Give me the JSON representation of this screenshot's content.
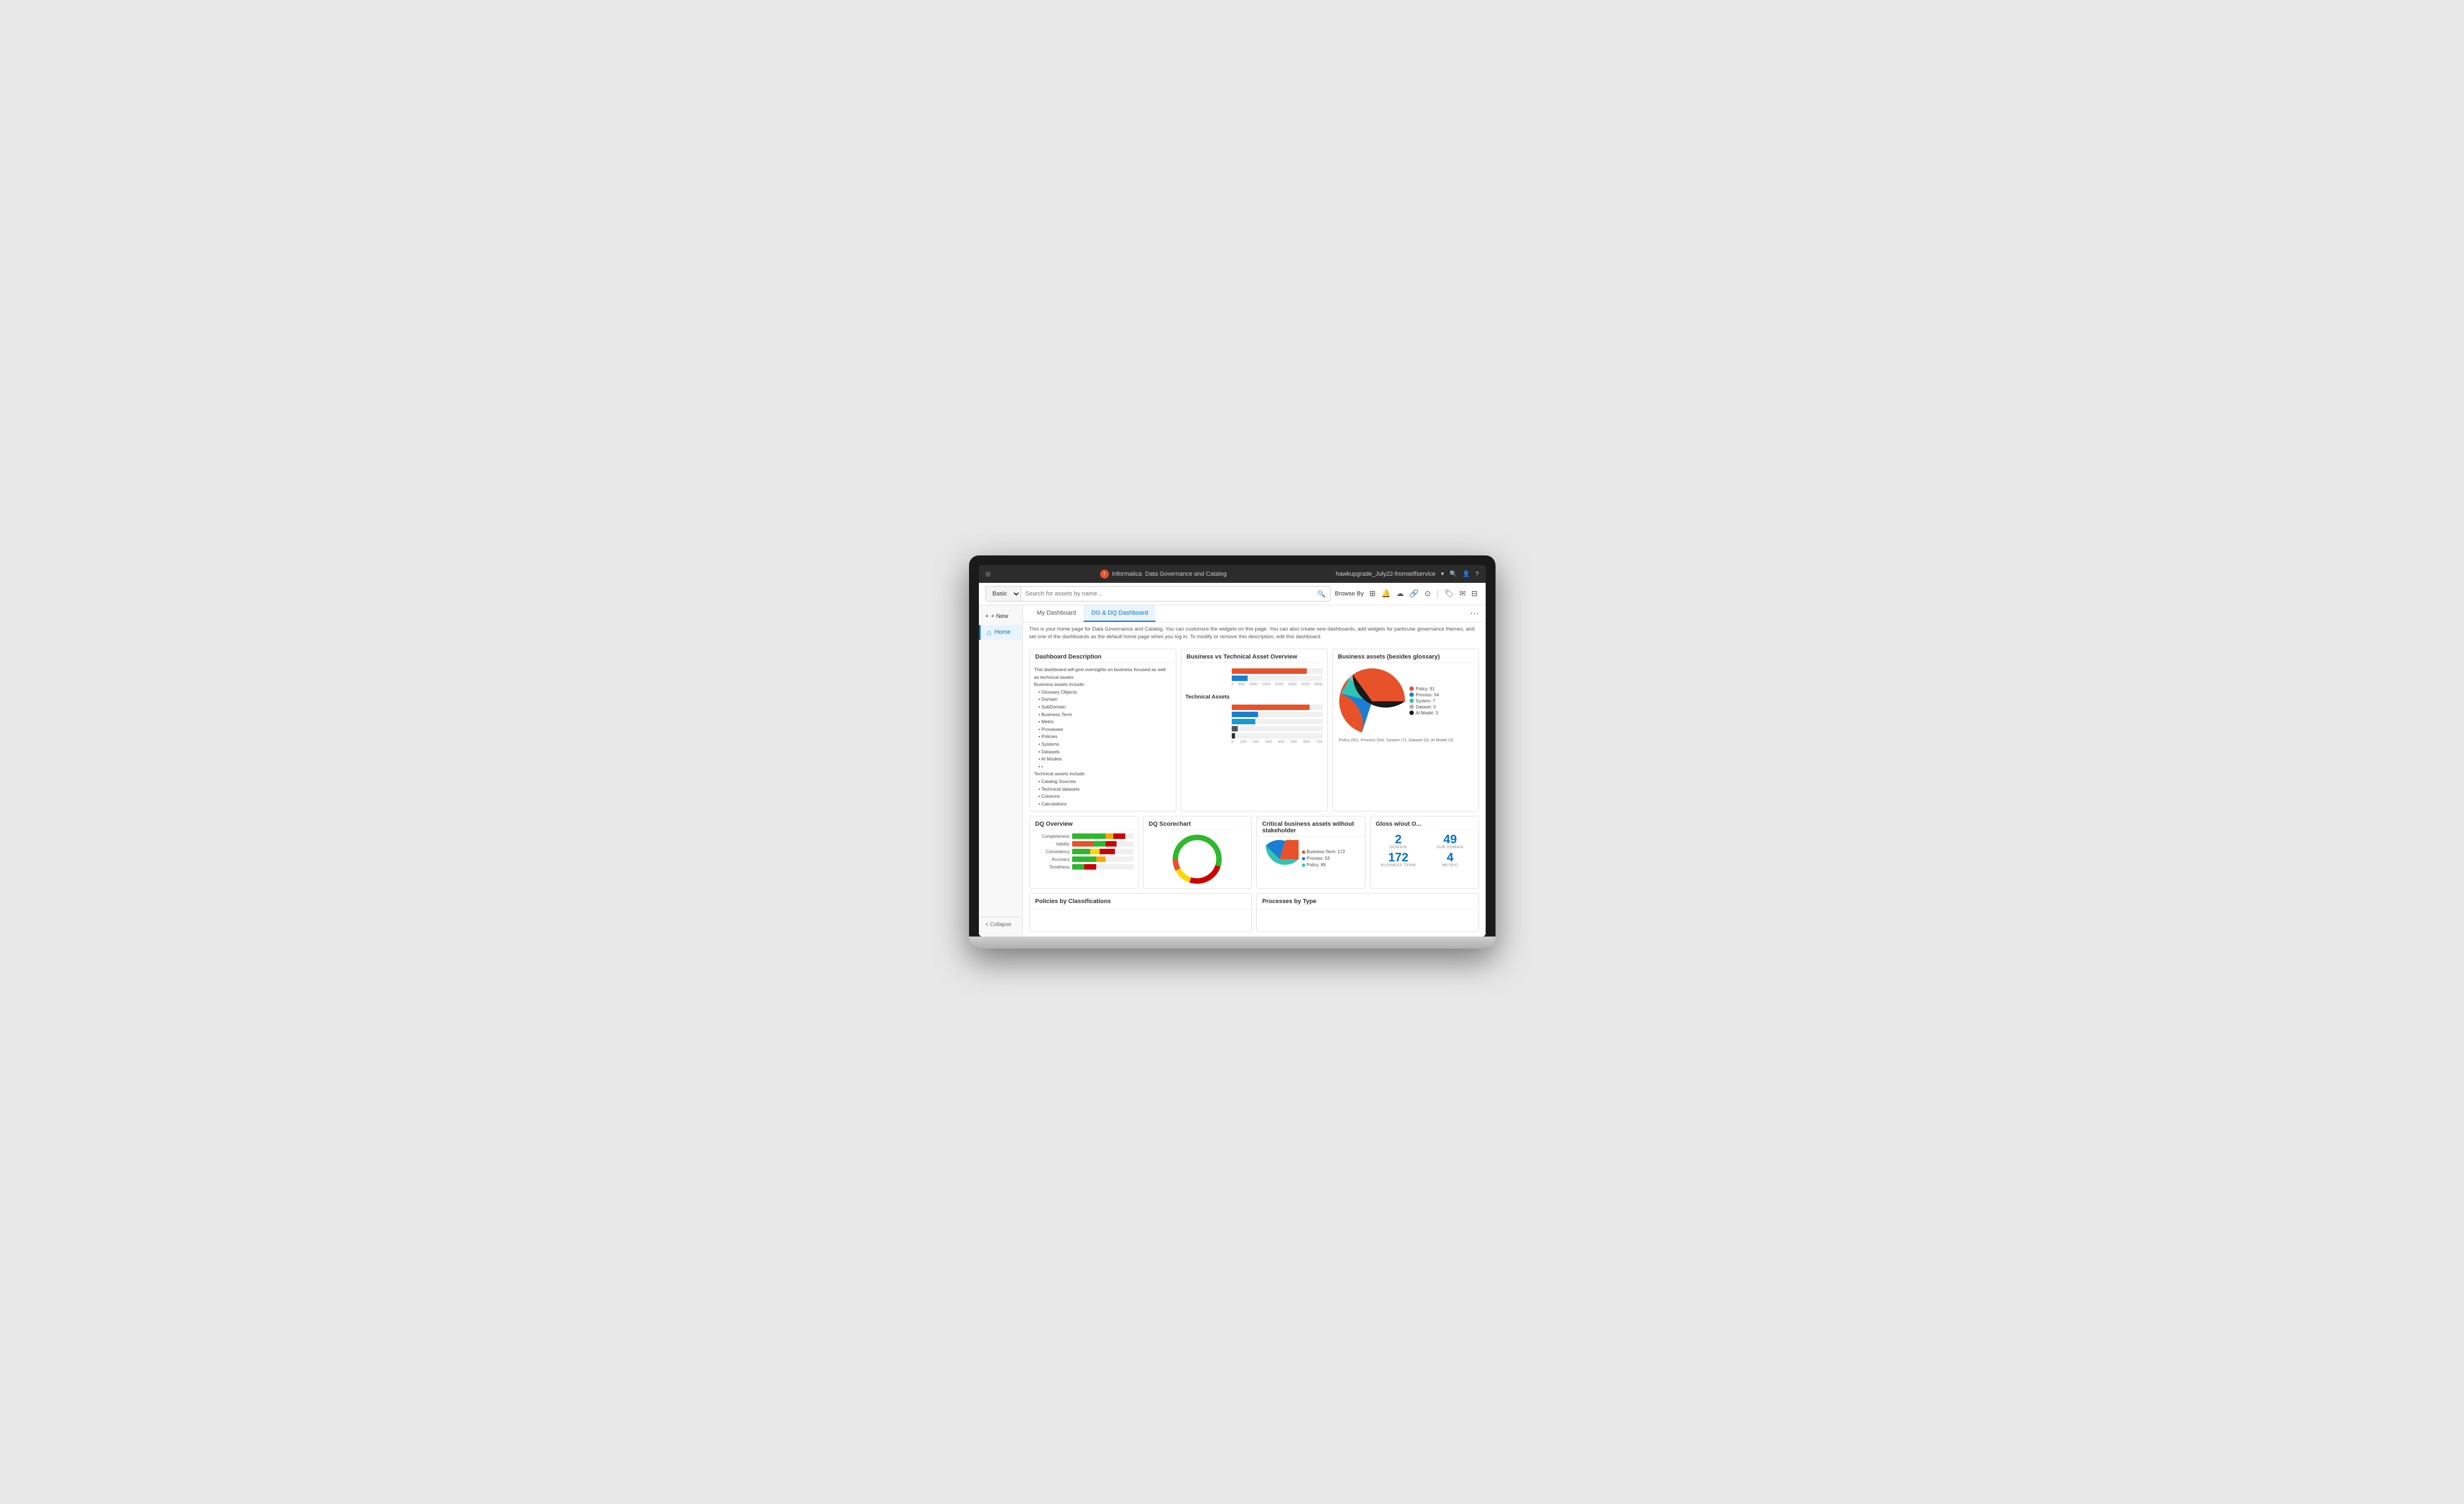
{
  "app": {
    "title": "Informatica",
    "subtitle": "Data Governance and Catalog",
    "user": "hawkupgrade_July22-fromselfservice",
    "logo_symbol": "i"
  },
  "search": {
    "type_options": [
      "Basic"
    ],
    "placeholder": "Search for assets by name...",
    "browse_by_label": "Browse By"
  },
  "sidebar": {
    "new_label": "+ New",
    "home_label": "Home",
    "collapse_label": "< Collapse"
  },
  "tabs": {
    "my_dashboard": "My Dashboard",
    "dg_dq_dashboard": "DG & DQ Dashboard",
    "more_icon": "⋯"
  },
  "description_text": "This is your home page for Data Governance and Catalog. You can customize the widgets on this page. You can also create new dashboards, add widgets for particular governance themes, and set one of the dashboards as the default home page when you log in. To modify or remove this description, edit this dashboard.",
  "widgets": {
    "dashboard_description": {
      "title": "Dashboard Description",
      "intro": "This dashboard will give oversights on business focused as well as technical assets",
      "business_assets_header": "Business assets include:",
      "business_assets": [
        "Glossary Objects:",
        "Domain",
        "SubDomain",
        "Business Term",
        "Metric",
        "Processes",
        "Policies",
        "Systems",
        "Datasets",
        "AI Models",
        "•"
      ],
      "technical_assets_header": "Technical assets include:",
      "technical_assets": [
        "Catalog Sources",
        "Technical datasets",
        "Columns",
        "Calculations"
      ]
    },
    "business_vs_technical": {
      "title": "Business vs Technical Asset Overview",
      "bars": [
        {
          "label": "",
          "value": 2900,
          "max": 3500,
          "color": "#e8522a"
        },
        {
          "label": "",
          "value": 650,
          "max": 3500,
          "color": "#1a7fd4"
        }
      ],
      "axis_labels": [
        "0",
        "500",
        "1000",
        "1500",
        "2000",
        "2500",
        "3000",
        "3500"
      ]
    },
    "technical_assets": {
      "title": "Technical Assets",
      "bars": [
        {
          "label": "",
          "value": 600,
          "max": 700,
          "color": "#e8522a"
        },
        {
          "label": "",
          "value": 200,
          "max": 700,
          "color": "#1a7fd4"
        },
        {
          "label": "",
          "value": 180,
          "max": 700,
          "color": "#1a9ad4"
        },
        {
          "label": "",
          "value": 50,
          "max": 700,
          "color": "#2c2c2c"
        },
        {
          "label": "",
          "value": 30,
          "max": 700,
          "color": "#444"
        }
      ],
      "axis_labels": [
        "0",
        "100",
        "200",
        "300",
        "400",
        "500",
        "600",
        "700"
      ]
    },
    "business_assets_pie": {
      "title": "Business assets (besides glossary)",
      "legend": [
        {
          "label": "Policy: 91",
          "color": "#e8522a"
        },
        {
          "label": "Process: 54",
          "color": "#1a7fd4"
        },
        {
          "label": "System: 7",
          "color": "#2ec4b6"
        },
        {
          "label": "Dataset: 0",
          "color": "#b0b0b0"
        },
        {
          "label": "AI Model: 3",
          "color": "#1a1a1a"
        }
      ],
      "legend_note": "Policy (91), Process (54), System (7), Dataset (0), AI Model (3)"
    },
    "dq_overview": {
      "title": "DQ Overview",
      "rows": [
        {
          "label": "Completeness",
          "segments": [
            {
              "pct": 55,
              "color": "#2eb82e"
            },
            {
              "pct": 12,
              "color": "#ffa500"
            },
            {
              "pct": 20,
              "color": "#cc0000"
            }
          ]
        },
        {
          "label": "Validity",
          "segments": [
            {
              "pct": 35,
              "color": "#e8522a"
            },
            {
              "pct": 20,
              "color": "#2eb82e"
            },
            {
              "pct": 18,
              "color": "#cc0000"
            }
          ]
        },
        {
          "label": "Consistency",
          "segments": [
            {
              "pct": 30,
              "color": "#2eb82e"
            },
            {
              "pct": 15,
              "color": "#ffd700"
            },
            {
              "pct": 25,
              "color": "#cc0000"
            }
          ]
        },
        {
          "label": "Accuracy",
          "segments": [
            {
              "pct": 40,
              "color": "#2eb82e"
            },
            {
              "pct": 15,
              "color": "#ffa500"
            }
          ]
        },
        {
          "label": "Timeliness",
          "segments": [
            {
              "pct": 20,
              "color": "#2eb82e"
            },
            {
              "pct": 20,
              "color": "#cc0000"
            }
          ]
        }
      ]
    },
    "dq_scorechart": {
      "title": "DQ Scorechart"
    },
    "critical_business": {
      "title": "Critical business assets without stakeholder",
      "legend": [
        {
          "label": "Business Term: 172",
          "color": "#e8522a"
        },
        {
          "label": "Process: 53",
          "color": "#1a7fd4"
        },
        {
          "label": "Policy: 89",
          "color": "#2ec4b6"
        }
      ]
    },
    "gloss_without": {
      "title": "Gloss w/out O...",
      "cells": [
        {
          "value": "2",
          "label": "DOMAIN"
        },
        {
          "value": "49",
          "label": "SUB DOMAIN"
        },
        {
          "value": "172",
          "label": "BUSINESS TERM"
        },
        {
          "value": "4",
          "label": "METRIC"
        }
      ]
    },
    "policies_by_classifications": {
      "title": "Policies by Classifications"
    },
    "processes_by_type": {
      "title": "Processes by Type"
    }
  }
}
